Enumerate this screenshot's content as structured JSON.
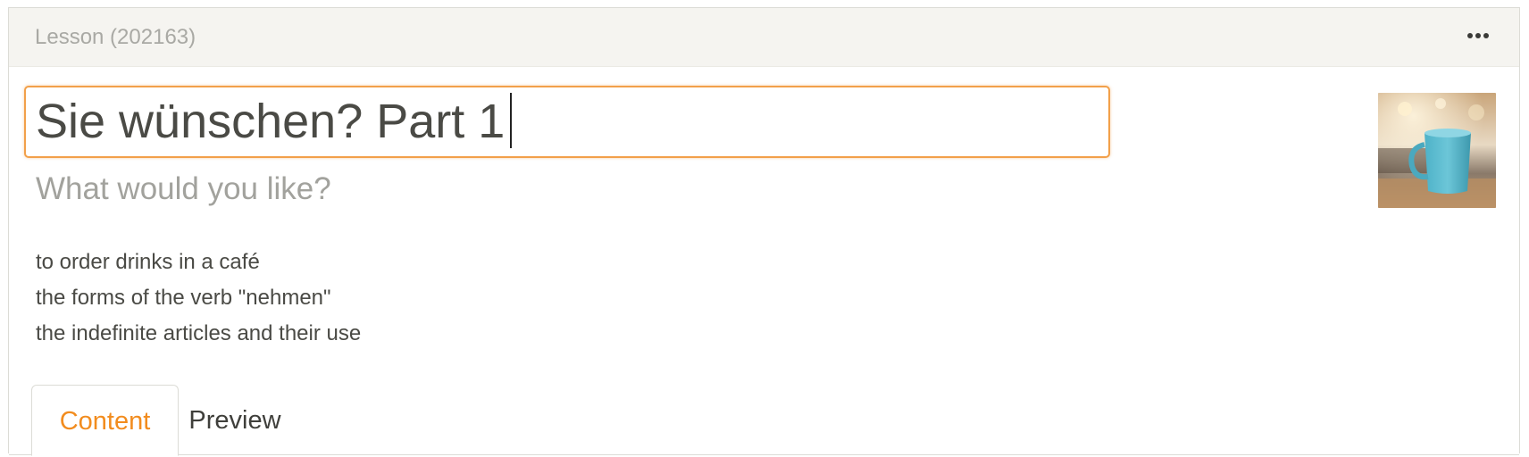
{
  "header": {
    "title": "Lesson (202163)",
    "menu_icon": "more-horizontal-icon"
  },
  "lesson": {
    "title_value": "Sie wünschen? Part 1",
    "subtitle": "What would you like?",
    "objectives": [
      "to order drinks in a café",
      "the forms of the verb \"nehmen\"",
      "the indefinite articles and their use"
    ],
    "thumbnail_alt": "Blue coffee mug in a café"
  },
  "tabs": [
    {
      "label": "Content",
      "active": true
    },
    {
      "label": "Preview",
      "active": false
    }
  ],
  "colors": {
    "accent": "#f28c1e",
    "focus_border": "#f2a04a",
    "header_bg": "#f5f4f0",
    "muted_text": "#a2a29d",
    "body_text": "#4a4a45"
  }
}
